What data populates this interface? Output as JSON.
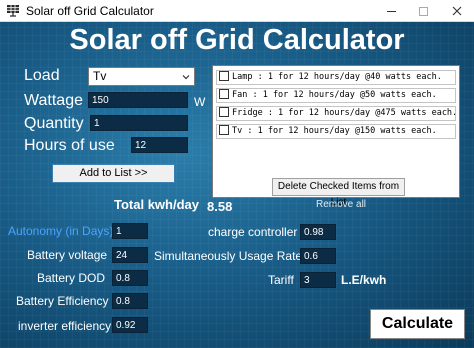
{
  "window": {
    "title": "Solar off Grid Calculator"
  },
  "heading": "Solar off Grid Calculator",
  "inputs": {
    "load_label": "Load",
    "load_value": "Tv",
    "wattage_label": "Wattage",
    "wattage_value": "150",
    "wattage_unit": "W",
    "quantity_label": "Quantity",
    "quantity_value": "1",
    "hours_label": "Hours of use",
    "hours_value": "12"
  },
  "buttons": {
    "add_to_list": "Add to List >>",
    "delete_checked": "Delete Checked Items from List",
    "remove_all": "Remove all",
    "calculate": "Calculate"
  },
  "load_list": [
    "Lamp : 1 for 12 hours/day @40 watts each.",
    "Fan : 1 for 12 hours/day @50 watts each.",
    "Fridge : 1 for 12 hours/day @475 watts each.",
    "Tv : 1 for 12 hours/day @150 watts each."
  ],
  "totals": {
    "kwh_label": "Total kwh/day",
    "kwh_value": "8.58"
  },
  "parameters": {
    "autonomy_label": "Autonomy (in Days)",
    "autonomy_value": "1",
    "battery_voltage_label": "Battery voltage",
    "battery_voltage_value": "24",
    "battery_dod_label": "Battery DOD",
    "battery_dod_value": "0.8",
    "battery_efficiency_label": "Battery Efficiency",
    "battery_efficiency_value": "0.8",
    "inverter_efficiency_label": "inverter efficiency",
    "inverter_efficiency_value": "0.92",
    "charge_controller_label": "charge controller",
    "charge_controller_value": "0.98",
    "simultaneous_usage_label": "Simultaneously Usage Rate",
    "simultaneous_usage_value": "0.6",
    "tariff_label": "Tariff",
    "tariff_value": "3",
    "tariff_unit": "L.E/kwh"
  },
  "colors": {
    "panel_dark": "#0b3a5a",
    "panel_light": "#2b7eab",
    "autonomy_label": "#4aa3ff",
    "field_bg": "#0c2c45"
  },
  "icons": {
    "app": "solar-panel-icon",
    "minimize": "minimize-icon",
    "maximize": "maximize-icon",
    "close": "close-icon",
    "dropdown": "chevron-down-icon"
  }
}
